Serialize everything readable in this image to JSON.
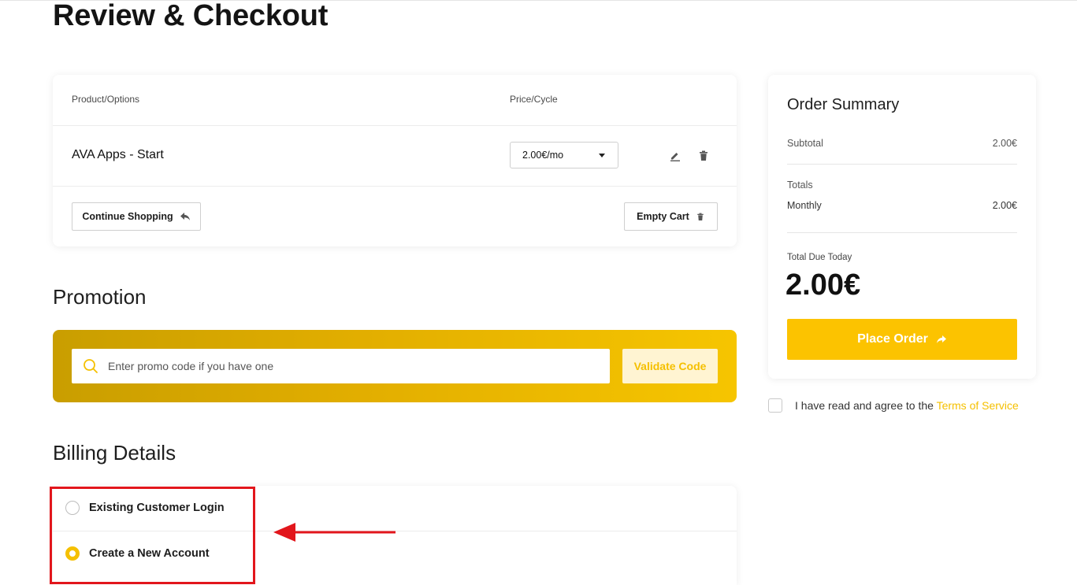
{
  "page": {
    "title": "Review & Checkout"
  },
  "cart": {
    "col_product": "Product/Options",
    "col_price": "Price/Cycle",
    "items": [
      {
        "name": "AVA Apps - Start",
        "cycle": "2.00€/mo"
      }
    ],
    "continue_label": "Continue Shopping",
    "empty_label": "Empty Cart"
  },
  "promotion": {
    "title": "Promotion",
    "placeholder": "Enter promo code if you have one",
    "validate_label": "Validate Code"
  },
  "billing": {
    "title": "Billing Details",
    "options": [
      {
        "label": "Existing Customer Login",
        "selected": false
      },
      {
        "label": "Create a New Account",
        "selected": true
      }
    ]
  },
  "summary": {
    "title": "Order Summary",
    "subtotal_label": "Subtotal",
    "subtotal_value": "2.00€",
    "totals_label": "Totals",
    "monthly_label": "Monthly",
    "monthly_value": "2.00€",
    "due_label": "Total Due Today",
    "due_value": "2.00€",
    "place_order_label": "Place Order"
  },
  "terms": {
    "text": "I have read and agree to the",
    "link": "Terms of Service"
  },
  "colors": {
    "accent": "#f5c000",
    "annotation": "#e2161c"
  }
}
